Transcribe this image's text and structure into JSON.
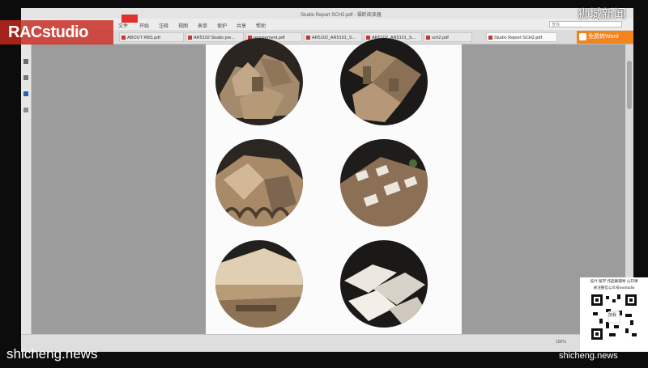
{
  "window": {
    "title": "Studio Report SCH2.pdf - 福昕阅读器"
  },
  "menubar": {
    "items": [
      "文件",
      "开始",
      "注释",
      "视图",
      "表单",
      "保护",
      "共享",
      "帮助"
    ],
    "search_placeholder": "查找"
  },
  "tabs": [
    {
      "label": "ABOUT RBS.pdf",
      "active": false
    },
    {
      "label": "AR5102 Studio pre...",
      "active": false
    },
    {
      "label": "requirement.pdf",
      "active": false
    },
    {
      "label": "AR5102_AR5101_S...",
      "active": false
    },
    {
      "label": "AR5102_AR5101_S...",
      "active": false
    },
    {
      "label": "sch2.pdf",
      "active": false
    },
    {
      "label": "Studio Report SCH2.pdf",
      "active": true
    }
  ],
  "convert_button": {
    "label": "免费转Word"
  },
  "status": {
    "zoom": "100%"
  },
  "watermarks": {
    "logo": "RACstudio",
    "top_right": "狮城新闻",
    "bottom_left": "shicheng.news",
    "bottom_right": "shicheng.news"
  },
  "promo": {
    "line1": "设计 留学 作品集辅导 公开课",
    "line2": "关注微信公众号racstudio",
    "qr_center": "加我"
  },
  "colors": {
    "accent": "#f1841d",
    "brand_red": "#c8281e",
    "model_sand": "#a88b6a",
    "model_white": "#e8e4dc"
  }
}
